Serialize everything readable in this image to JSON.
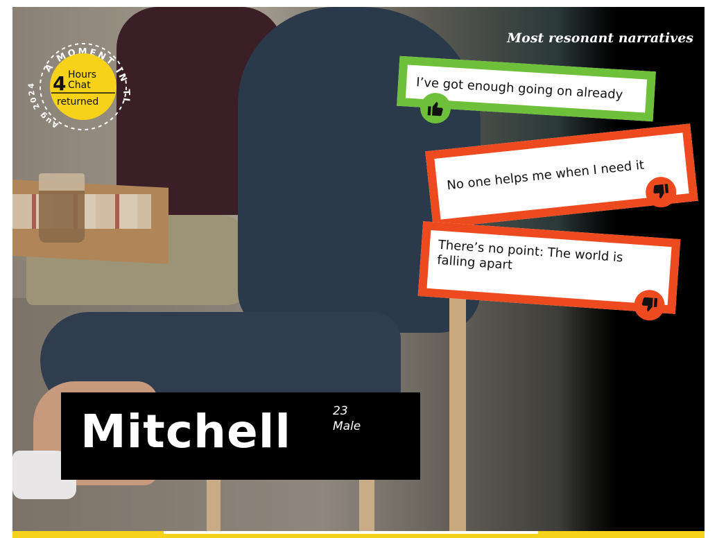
{
  "headline": "Most resonant narratives",
  "stamp": {
    "ring_text": "A MOMENT IN TIME",
    "date_text": "Aug 2024",
    "number": "4",
    "line1": "Hours",
    "line2": "Chat",
    "line3": "returned"
  },
  "narratives": [
    {
      "text": "I’ve got enough going on already",
      "sentiment": "positive",
      "icon": "thumbs-up-icon",
      "color": "#6ebf3a"
    },
    {
      "text": "No one helps me when I need it",
      "sentiment": "negative",
      "icon": "thumbs-down-icon",
      "color": "#ee4a1f"
    },
    {
      "text": "There’s no point: The world is falling apart",
      "sentiment": "negative",
      "icon": "thumbs-down-icon",
      "color": "#ee4a1f"
    }
  ],
  "person": {
    "name": "Mitchell",
    "age": "23",
    "gender": "Male"
  },
  "colors": {
    "accent_yellow": "#f6d21b",
    "positive_green": "#6ebf3a",
    "negative_red": "#ee4a1f"
  }
}
